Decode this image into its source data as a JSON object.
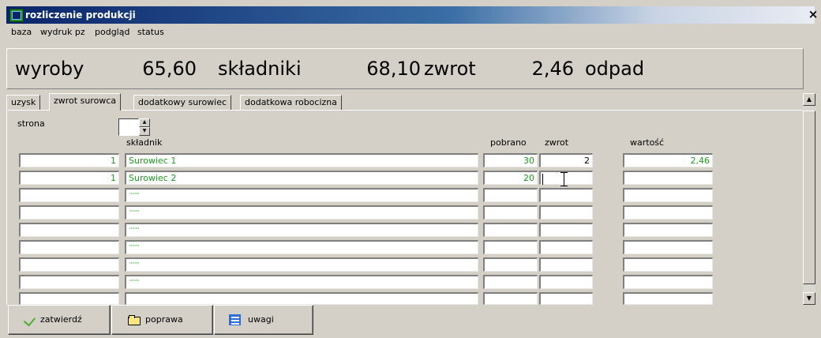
{
  "window": {
    "title": "rozliczenie produkcji",
    "close_glyph": "×",
    "icon": "app-icon"
  },
  "menu": [
    "baza",
    "wydruk pz",
    "podgląd",
    "status"
  ],
  "summary": {
    "wyroby_label": "wyroby",
    "wyroby_value": "65,60",
    "skladniki_label": "składniki",
    "skladniki_value": "68,10",
    "zwrot_label": "zwrot",
    "zwrot_value": "2,46",
    "odpad_label": "odpad"
  },
  "tabs": [
    {
      "label": "uzysk",
      "active": false
    },
    {
      "label": "zwrot surowca",
      "active": true
    },
    {
      "label": "dodatkowy surowiec",
      "active": false
    },
    {
      "label": "dodatkowa robocizna",
      "active": false
    }
  ],
  "form": {
    "strona_label": "strona",
    "strona_value": "",
    "columns": {
      "skladnik": "składnik",
      "pobrano": "pobrano",
      "zwrot": "zwrot",
      "wartosc": "wartość"
    },
    "rows": [
      {
        "num": "1",
        "name": "Surowiec 1",
        "pobrano": "30",
        "zwrot": "2",
        "wartosc": "2,46"
      },
      {
        "num": "1",
        "name": "Surowiec 2",
        "pobrano": "20",
        "zwrot": "",
        "wartosc": ""
      },
      {
        "num": "",
        "name": "·······",
        "pobrano": "",
        "zwrot": "",
        "wartosc": ""
      },
      {
        "num": "",
        "name": "·······",
        "pobrano": "",
        "zwrot": "",
        "wartosc": ""
      },
      {
        "num": "",
        "name": "·······",
        "pobrano": "",
        "zwrot": "",
        "wartosc": ""
      },
      {
        "num": "",
        "name": "·······",
        "pobrano": "",
        "zwrot": "",
        "wartosc": ""
      },
      {
        "num": "",
        "name": "·······",
        "pobrano": "",
        "zwrot": "",
        "wartosc": ""
      },
      {
        "num": "",
        "name": "·······",
        "pobrano": "",
        "zwrot": "",
        "wartosc": ""
      },
      {
        "num": "",
        "name": "",
        "pobrano": "",
        "zwrot": "",
        "wartosc": ""
      }
    ]
  },
  "buttons": {
    "approve": {
      "label": "zatwierdź",
      "icon": "checkmark-icon"
    },
    "correct": {
      "label": "poprawa",
      "icon": "folder-icon"
    },
    "notes": {
      "label": "uwagi",
      "icon": "notes-icon"
    }
  },
  "colors": {
    "titlebar": "#0a246a",
    "value_text": "#1e9a1e",
    "face": "#d4d0c8"
  }
}
